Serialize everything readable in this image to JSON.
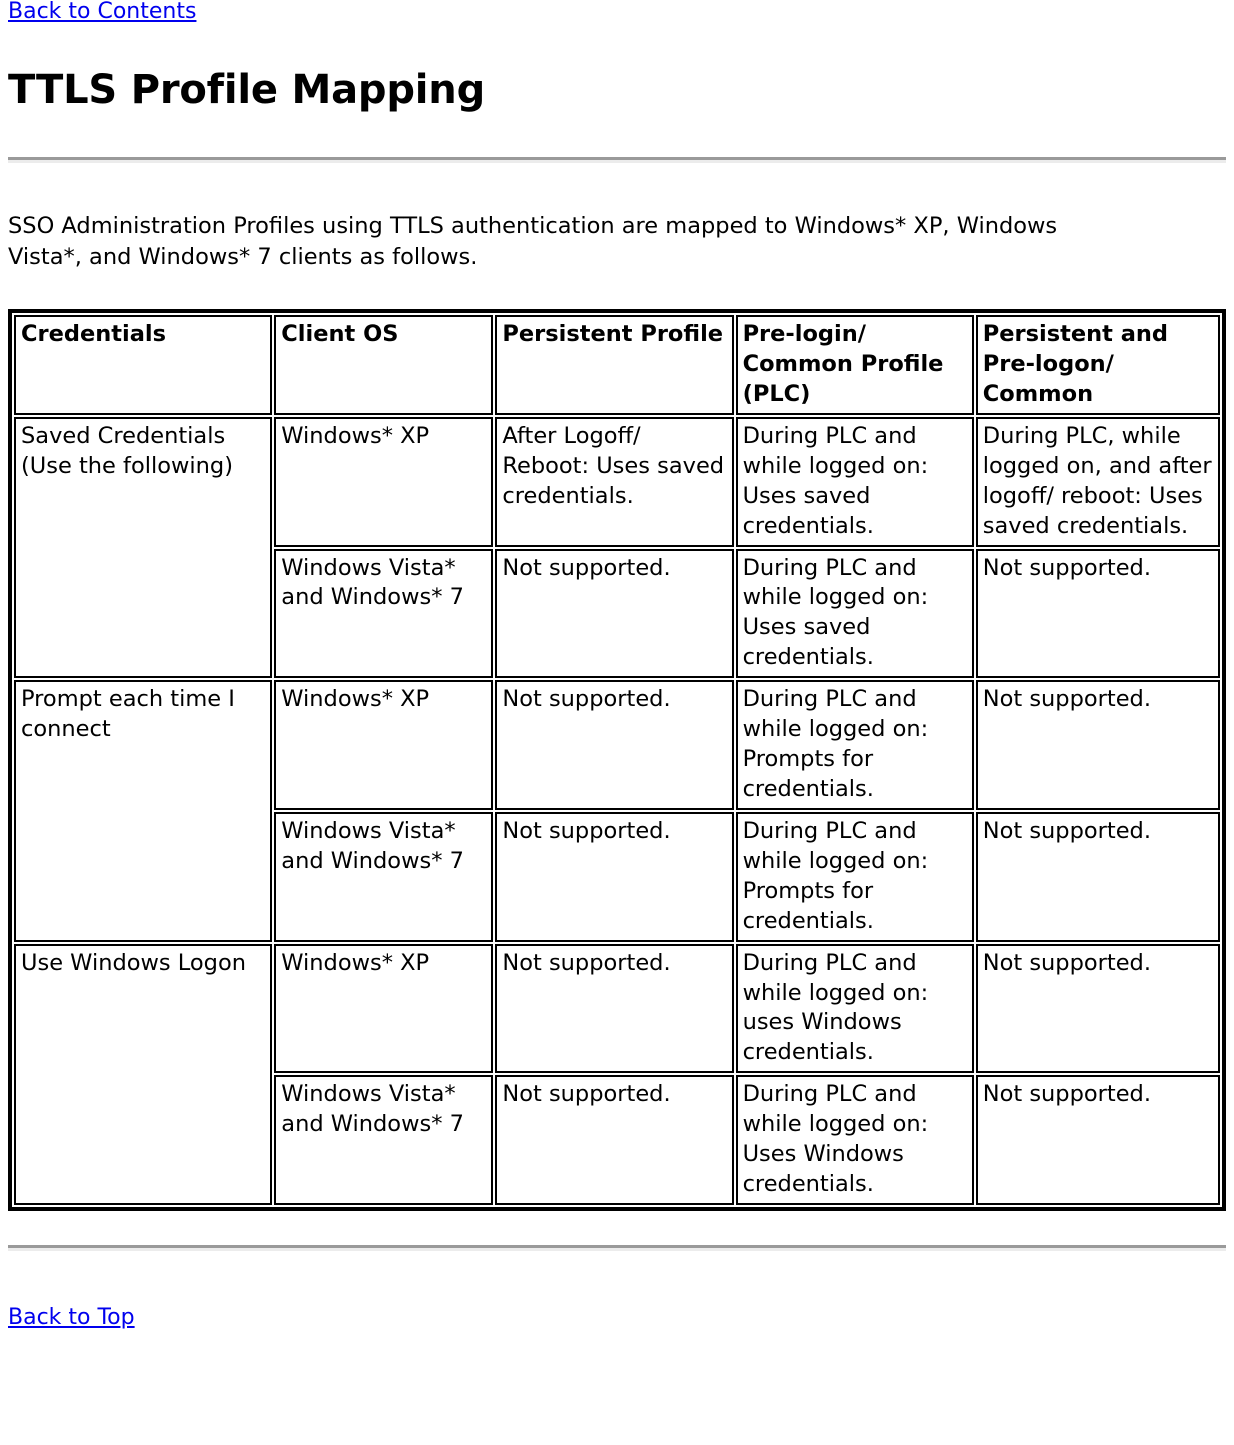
{
  "nav": {
    "back_to_contents": "Back to Contents",
    "back_to_top": "Back to Top"
  },
  "header": {
    "title": "TTLS Profile Mapping"
  },
  "intro": {
    "paragraph": "SSO Administration Profiles using TTLS authentication are mapped to Windows* XP, Windows Vista*, and Windows* 7 clients as follows."
  },
  "table": {
    "columns": [
      "Credentials",
      "Client OS",
      "Persistent Profile",
      "Pre-login/ Common Profile (PLC)",
      "Persistent and Pre-logon/ Common"
    ],
    "groups": [
      {
        "credentials": "Saved Credentials (Use the following)",
        "rows": [
          {
            "client_os": "Windows* XP",
            "persistent_profile": "After Logoff/ Reboot: Uses saved credentials.",
            "plc": "During PLC and while logged on: Uses saved credentials.",
            "persistent_prelogon": "During PLC, while logged on, and after logoff/ reboot: Uses saved credentials."
          },
          {
            "client_os": "Windows Vista* and Windows* 7",
            "persistent_profile": "Not supported.",
            "plc": "During PLC and while logged on: Uses saved credentials.",
            "persistent_prelogon": "Not supported."
          }
        ]
      },
      {
        "credentials": "Prompt each time I connect",
        "rows": [
          {
            "client_os": "Windows* XP",
            "persistent_profile": "Not supported.",
            "plc": "During PLC and while logged on: Prompts for credentials.",
            "persistent_prelogon": "Not supported."
          },
          {
            "client_os": "Windows Vista* and Windows* 7",
            "persistent_profile": "Not supported.",
            "plc": "During PLC and while logged on: Prompts for credentials.",
            "persistent_prelogon": "Not supported."
          }
        ]
      },
      {
        "credentials": "Use Windows Logon",
        "rows": [
          {
            "client_os": "Windows* XP",
            "persistent_profile": "Not supported.",
            "plc": "During PLC and while logged on: uses Windows credentials.",
            "persistent_prelogon": "Not supported."
          },
          {
            "client_os": "Windows Vista* and Windows* 7",
            "persistent_profile": "Not supported.",
            "plc": "During PLC and while logged on: Uses Windows credentials.",
            "persistent_prelogon": "Not supported."
          }
        ]
      }
    ]
  },
  "colors": {
    "link": "#0000ee",
    "text": "#000000",
    "rule": "#9a9a9a",
    "border": "#000000"
  }
}
